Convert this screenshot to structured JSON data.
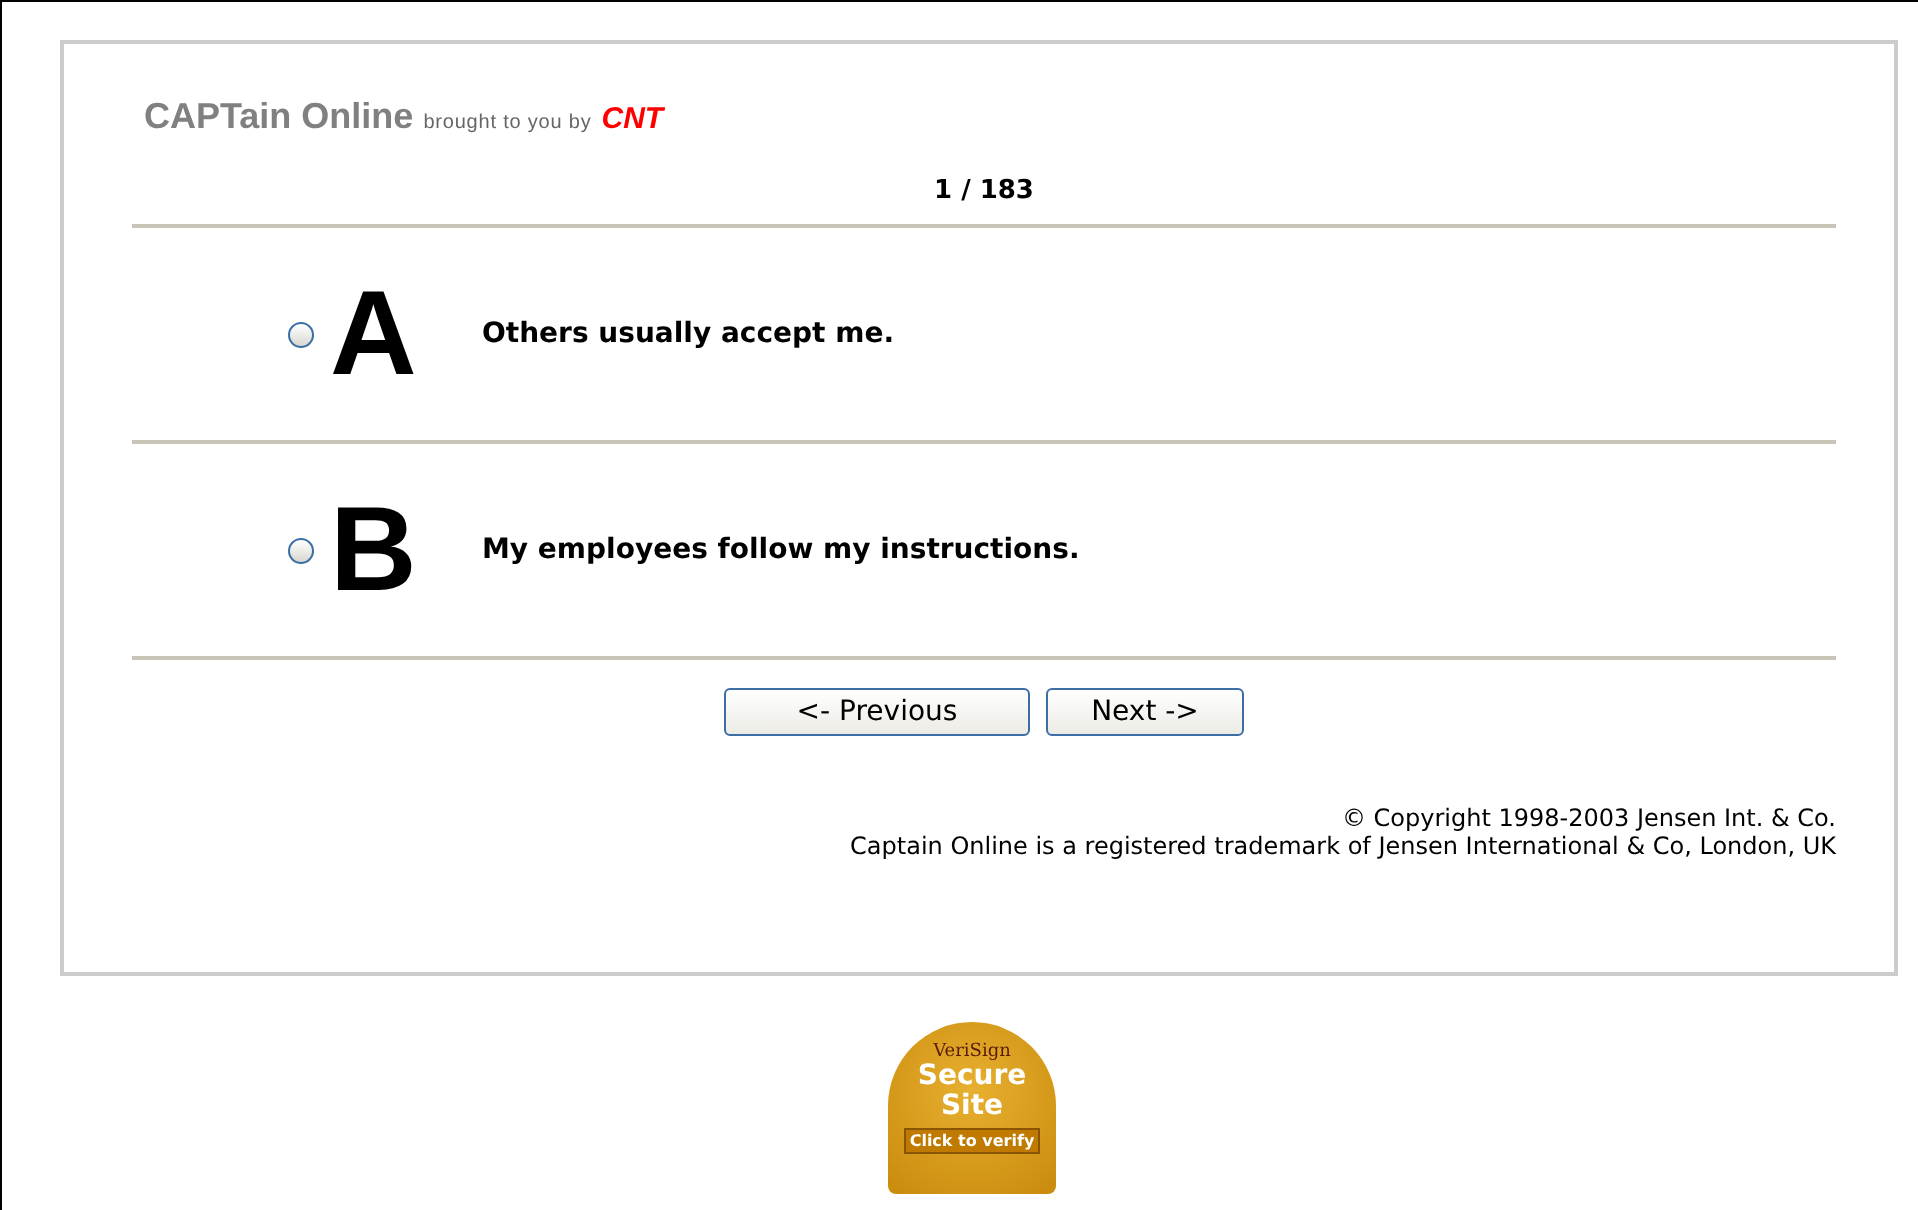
{
  "header": {
    "brand": "CAPTain Online",
    "tagline": "brought to you by",
    "partner": "CNT"
  },
  "progress": "1 / 183",
  "options": [
    {
      "letter": "A",
      "text": "Others usually accept me.",
      "selected": false
    },
    {
      "letter": "B",
      "text": "My employees follow my instructions.",
      "selected": false
    }
  ],
  "buttons": [
    {
      "label": "<- Previous",
      "kind": "previous"
    },
    {
      "label": "Next ->",
      "kind": "next"
    }
  ],
  "footer": {
    "copyright": "© Copyright 1998-2003 Jensen Int. & Co.",
    "trademark": "Captain Online is a registered trademark of Jensen International & Co, London, UK"
  },
  "seal": {
    "brand": "VeriSign",
    "line_1": "Secure",
    "line_2": "Site",
    "action": "Click to verify"
  }
}
